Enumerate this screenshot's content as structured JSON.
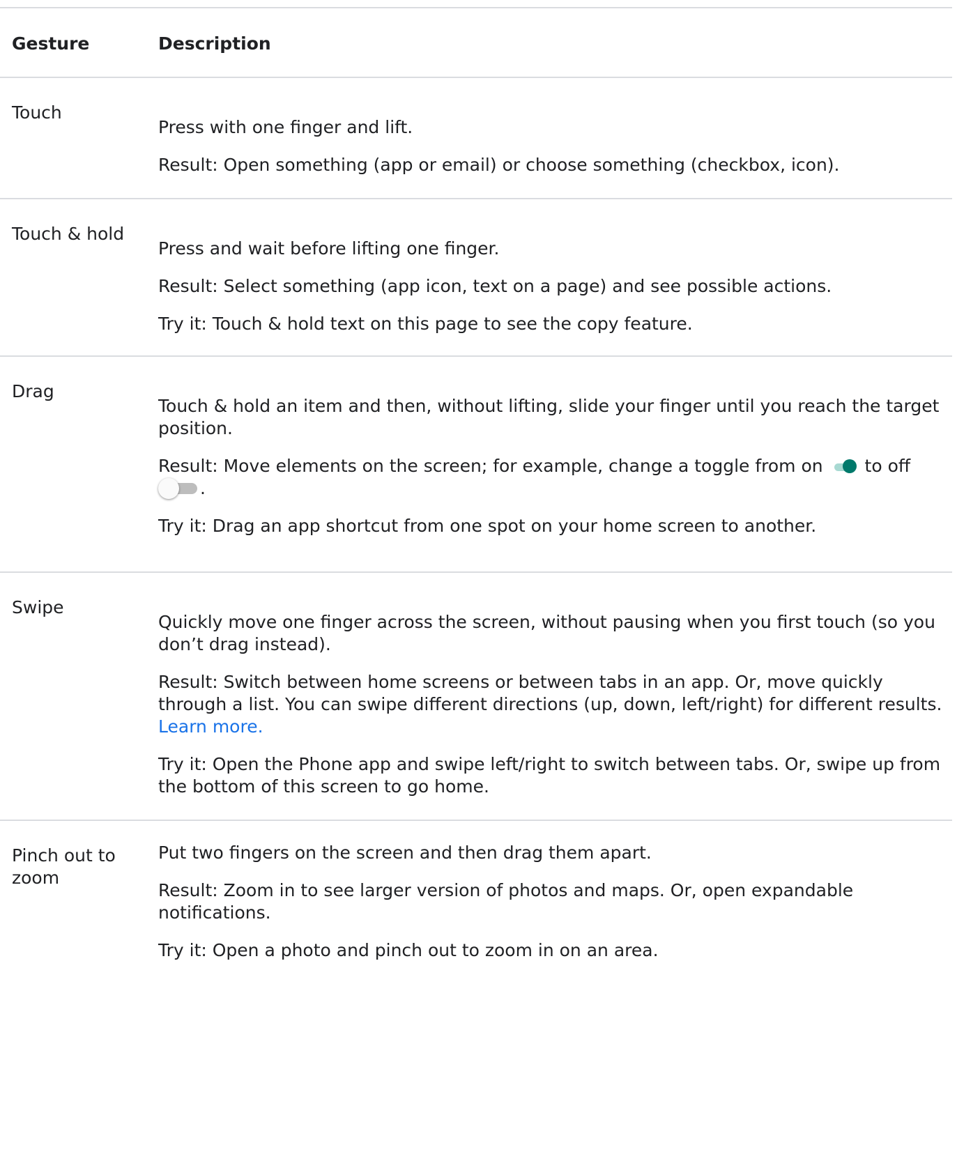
{
  "table": {
    "header": {
      "gesture": "Gesture",
      "description": "Description"
    },
    "rows": [
      {
        "gesture": "Touch",
        "paragraphs": [
          "Press with one finger and lift.",
          "Result: Open something (app or email) or choose something (checkbox, icon)."
        ]
      },
      {
        "gesture": "Touch & hold",
        "paragraphs": [
          "Press and wait before lifting one finger.",
          "Result: Select something (app icon, text on a page) and see possible actions.",
          "Try it: Touch & hold text on this page to see the copy feature."
        ]
      },
      {
        "gesture": "Drag",
        "paragraphs": [
          "Touch & hold an item and then, without lifting, slide your finger until you reach the target position."
        ],
        "result_before_on": "Result: Move elements on the screen; for example, change a toggle from on",
        "result_between": "to off",
        "result_after_off": ".",
        "try_it": "Try it: Drag an app shortcut from one spot on your home screen to another.",
        "toggle_on_icon": "toggle-on-icon",
        "toggle_off_icon": "toggle-off-icon",
        "toggle_on_color": "#00796b",
        "toggle_off_color": "#bdbdbd"
      },
      {
        "gesture": "Swipe",
        "paragraphs": [
          "Quickly move one finger across the screen, without pausing when you first touch (so you don’t drag instead)."
        ],
        "result_text": "Result: Switch between home screens or between tabs in an app. Or, move quickly through a list. You can swipe different directions (up, down, left/right) for different results.",
        "learn_more": "Learn more.",
        "try_it": "Try it: Open the Phone app and swipe left/right to switch between tabs. Or, swipe up from the bottom of this screen to go home.",
        "link_color": "#1a73e8"
      },
      {
        "gesture": "Pinch out to zoom",
        "paragraphs": [
          "Put two fingers on the screen and then drag them apart.",
          "Result: Zoom in to see larger version of photos and maps. Or, open expandable notifications.",
          "Try it: Open a photo and pinch out to zoom in on an area."
        ]
      }
    ]
  }
}
